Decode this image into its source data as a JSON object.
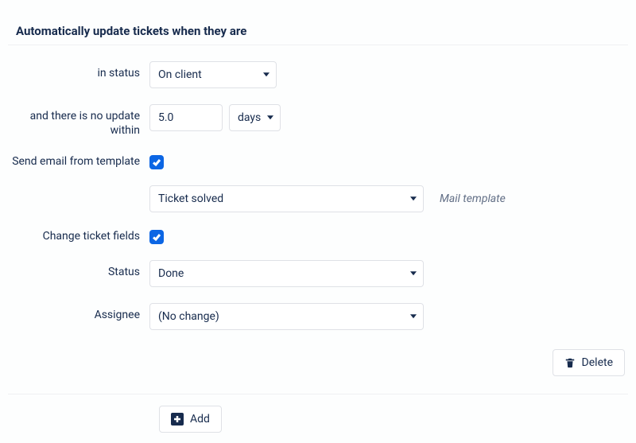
{
  "section": {
    "title": "Automatically update tickets when they are"
  },
  "labels": {
    "in_status": "in status",
    "no_update": "and there is no update within",
    "send_email": "Send email from template",
    "change_fields": "Change ticket fields",
    "status": "Status",
    "assignee": "Assignee",
    "mail_template_hint": "Mail template"
  },
  "values": {
    "status_trigger": "On client",
    "duration_value": "5.0",
    "duration_unit": "days",
    "send_email_checked": true,
    "mail_template": "Ticket solved",
    "change_fields_checked": true,
    "new_status": "Done",
    "new_assignee": "(No change)"
  },
  "buttons": {
    "delete": "Delete",
    "add": "Add"
  }
}
